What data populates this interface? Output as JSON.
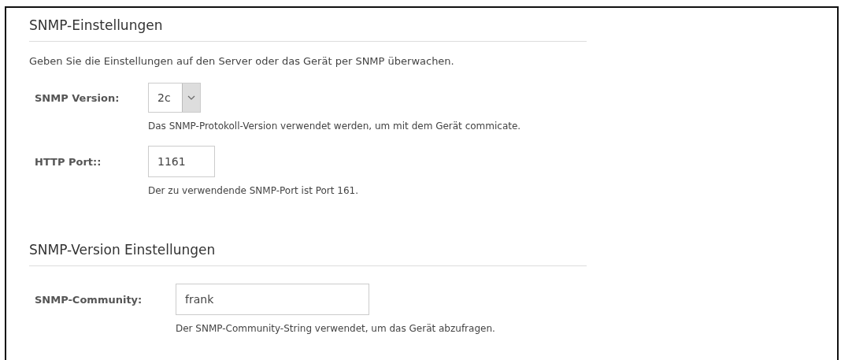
{
  "sections": [
    {
      "title": "SNMP-Einstellungen",
      "intro": "Geben Sie die Einstellungen auf den Server oder das Gerät per SNMP überwachen.",
      "fields": [
        {
          "kind": "select",
          "label": "SNMP Version:",
          "value": "2c",
          "help": "Das SNMP-Protokoll-Version verwendet werden, um mit dem Gerät commicate."
        },
        {
          "kind": "text",
          "label": "HTTP Port::",
          "value": "1161",
          "help": "Der zu verwendende SNMP-Port ist Port 161."
        }
      ]
    },
    {
      "title": "SNMP-Version Einstellungen",
      "fields": [
        {
          "kind": "text-wide",
          "label": "SNMP-Community:",
          "value": "frank",
          "help": "Der SNMP-Community-String verwendet, um das Gerät abzufragen."
        }
      ]
    }
  ]
}
